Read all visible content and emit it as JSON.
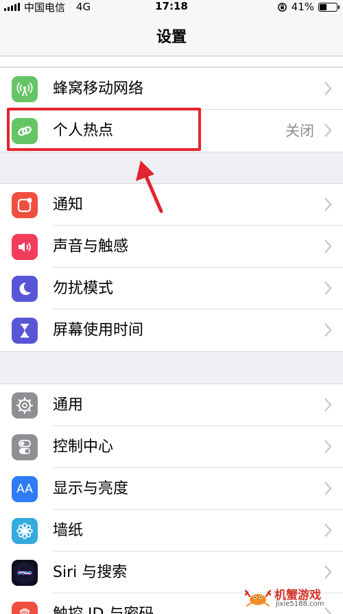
{
  "status_bar": {
    "carrier": "中国电信",
    "network": "4G",
    "time": "17:18",
    "battery": "41%",
    "battery_level": 0.41
  },
  "nav": {
    "title": "设置"
  },
  "group1": [
    {
      "id": "cellular",
      "label": "蜂窝移动网络",
      "icon": "antenna-icon",
      "color": "#65c466"
    },
    {
      "id": "hotspot",
      "label": "个人热点",
      "value": "关闭",
      "icon": "hotspot-link-icon",
      "color": "#65c466"
    }
  ],
  "group2": [
    {
      "id": "notifications",
      "label": "通知",
      "icon": "notification-icon",
      "color": "#f04e3f"
    },
    {
      "id": "sounds",
      "label": "声音与触感",
      "icon": "speaker-icon",
      "color": "#f13c5b"
    },
    {
      "id": "dnd",
      "label": "勿扰模式",
      "icon": "moon-icon",
      "color": "#5856d6"
    },
    {
      "id": "screentime",
      "label": "屏幕使用时间",
      "icon": "hourglass-icon",
      "color": "#5856d6"
    }
  ],
  "group3": [
    {
      "id": "general",
      "label": "通用",
      "icon": "gear-icon",
      "color": "#8e8e93"
    },
    {
      "id": "control",
      "label": "控制中心",
      "icon": "toggles-icon",
      "color": "#8e8e93"
    },
    {
      "id": "display",
      "label": "显示与亮度",
      "icon": "text-size-icon",
      "color": "#2f7cf6",
      "glyph": "AA"
    },
    {
      "id": "wallpaper",
      "label": "墙纸",
      "icon": "flower-icon",
      "color": "#35aadc"
    },
    {
      "id": "siri",
      "label": "Siri 与搜索",
      "icon": "siri-icon",
      "color": "#1a1a2e"
    },
    {
      "id": "touchid",
      "label": "触控 ID 与密码",
      "icon": "fingerprint-icon",
      "color": "#f04e3f"
    }
  ],
  "watermark": {
    "title": "机蟹游戏",
    "url": "jixie5188.com"
  },
  "annotation": {
    "highlight_color": "#e3232f"
  }
}
